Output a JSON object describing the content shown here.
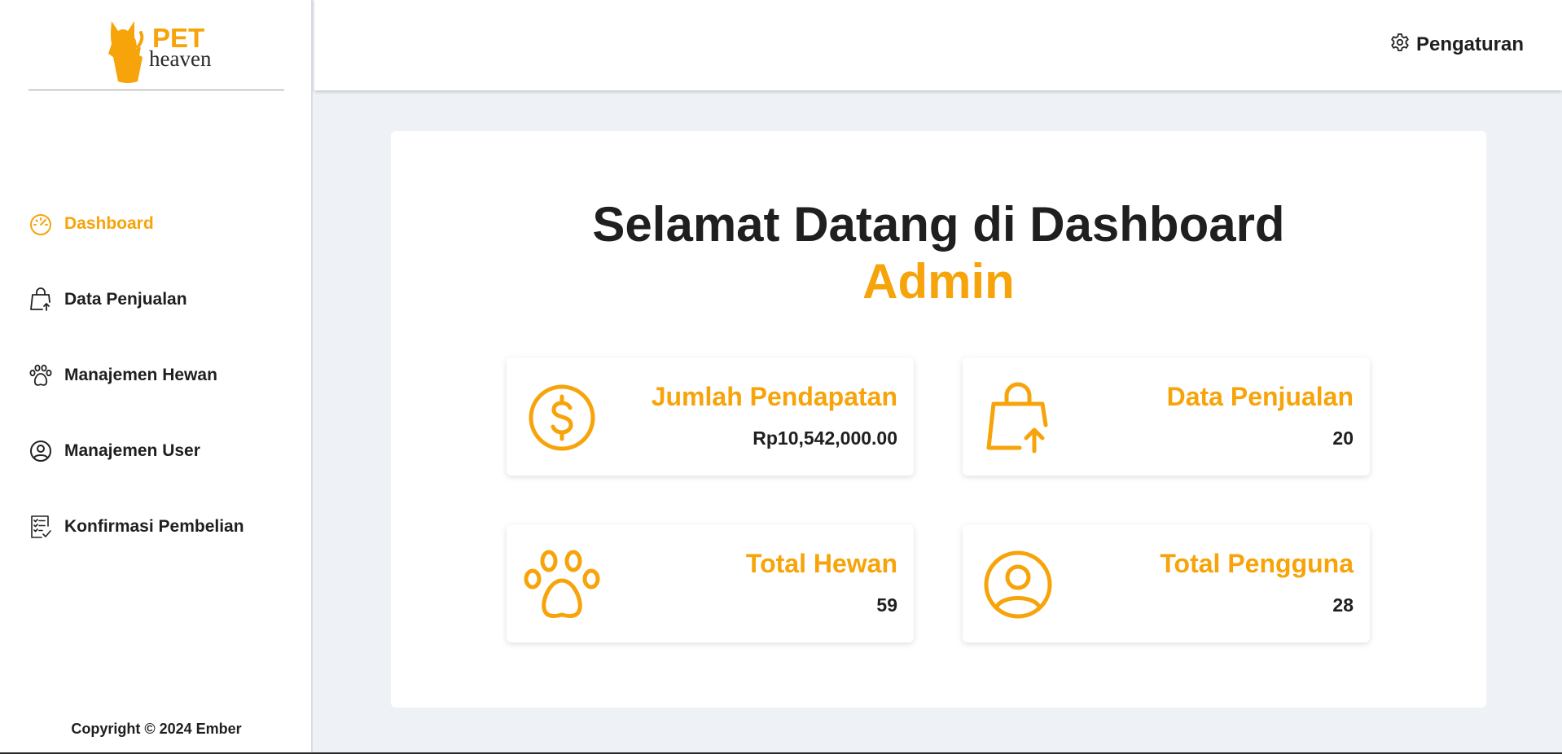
{
  "brand": {
    "pet": "PET",
    "heaven": "heaven",
    "color": "#f7a30a"
  },
  "sidebar": {
    "items": [
      {
        "label": "Dashboard",
        "icon": "speedometer-icon",
        "active": true
      },
      {
        "label": "Data Penjualan",
        "icon": "shopping-bag-upload-icon",
        "active": false
      },
      {
        "label": "Manajemen Hewan",
        "icon": "paw-icon",
        "active": false
      },
      {
        "label": "Manajemen User",
        "icon": "user-circle-icon",
        "active": false
      },
      {
        "label": "Konfirmasi Pembelian",
        "icon": "checklist-icon",
        "active": false
      }
    ],
    "copyright": "Copyright © 2024 Ember"
  },
  "header": {
    "settings_label": "Pengaturan",
    "settings_icon": "gear-icon"
  },
  "main": {
    "title": "Selamat Datang di Dashboard",
    "subtitle": "Admin",
    "cards": [
      {
        "label": "Jumlah Pendapatan",
        "value": "Rp10,542,000.00",
        "icon": "dollar-circle-icon"
      },
      {
        "label": "Data Penjualan",
        "value": "20",
        "icon": "shopping-bag-upload-icon"
      },
      {
        "label": "Total Hewan",
        "value": "59",
        "icon": "paw-icon"
      },
      {
        "label": "Total Pengguna",
        "value": "28",
        "icon": "user-circle-icon"
      }
    ]
  },
  "colors": {
    "accent": "#f7a30a",
    "text": "#1f1f1f",
    "background": "#eef2f7"
  }
}
